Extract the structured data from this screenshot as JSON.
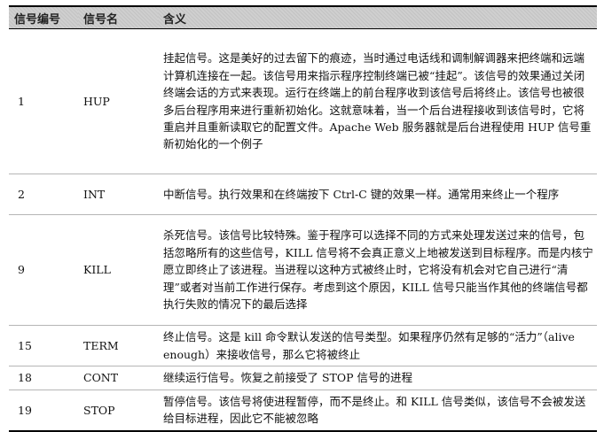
{
  "table": {
    "headers": [
      "信号编号",
      "信号名",
      "含义"
    ],
    "rows": [
      {
        "number": "1",
        "name": "HUP",
        "meaning": "挂起信号。这是美好的过去留下的痕迹，当时通过电话线和调制解调器来把终端和远端计算机连接在一起。该信号用来指示程序控制终端已被“挂起”。该信号的效果通过关闭终端会话的方式来表现。运行在终端上的前台程序收到该信号后将终止。该信号也被很多后台程序用来进行重新初始化。这就意味着，当一个后台进程接收到该信号时，它将重启并且重新读取它的配置文件。Apache Web 服务器就是后台进程使用 HUP 信号重新初始化的一个例子"
      },
      {
        "number": "2",
        "name": "INT",
        "meaning": "中断信号。执行效果和在终端按下 Ctrl-C 键的效果一样。通常用来终止一个程序"
      },
      {
        "number": "9",
        "name": "KILL",
        "meaning": "杀死信号。该信号比较特殊。鉴于程序可以选择不同的方式来处理发送过来的信号，包括忽略所有的这些信号，KILL 信号将不会真正意义上地被发送到目标程序。而是内核宁愿立即终止了该进程。当进程以这种方式被终止时，它将没有机会对它自己进行“清理”或者对当前工作进行保存。考虑到这个原因，KILL 信号只能当作其他的终端信号都执行失败的情况下的最后选择"
      },
      {
        "number": "15",
        "name": "TERM",
        "meaning": "终止信号。这是 kill 命令默认发送的信号类型。如果程序仍然有足够的“活力”（alive enough）来接收信号，那么它将被终止"
      },
      {
        "number": "18",
        "name": "CONT",
        "meaning": "继续运行信号。恢复之前接受了 STOP 信号的进程"
      },
      {
        "number": "19",
        "name": "STOP",
        "meaning": "暂停信号。该信号将使进程暂停，而不是终止。和 KILL 信号类似，该信号不会被发送给目标进程，因此它不能被忽略"
      }
    ]
  }
}
